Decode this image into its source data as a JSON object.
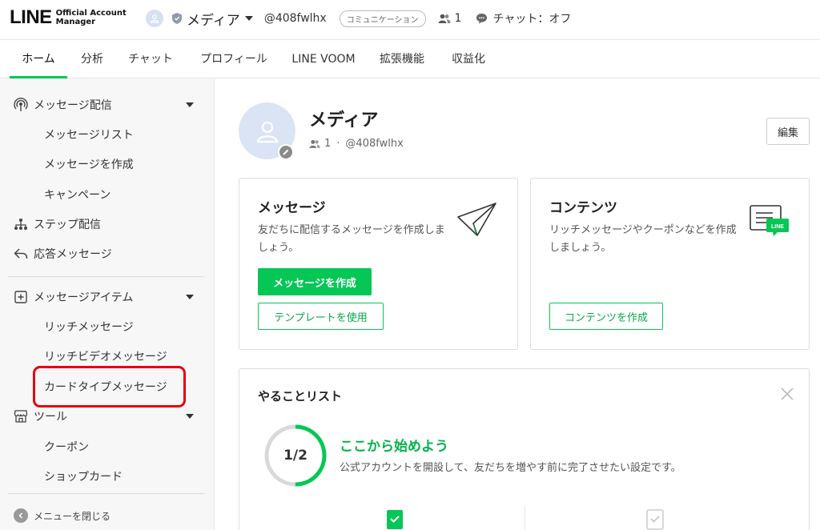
{
  "header": {
    "logo_main": "LINE",
    "logo_sub_1": "Official Account",
    "logo_sub_2": "Manager",
    "account_name": "メディア",
    "account_id": "@408fwlhx",
    "plan_badge": "コミュニケーション",
    "member_count": "1",
    "chat_status": "チャット：オフ"
  },
  "tabs": [
    {
      "label": "ホーム",
      "active": true
    },
    {
      "label": "分析"
    },
    {
      "label": "チャット"
    },
    {
      "label": "プロフィール"
    },
    {
      "label": "LINE VOOM"
    },
    {
      "label": "拡張機能"
    },
    {
      "label": "収益化"
    }
  ],
  "sidebar": {
    "message_delivery": "メッセージ配信",
    "message_list": "メッセージリスト",
    "create_message": "メッセージを作成",
    "campaign": "キャンペーン",
    "step_delivery": "ステップ配信",
    "auto_reply": "応答メッセージ",
    "message_items": "メッセージアイテム",
    "rich_message": "リッチメッセージ",
    "rich_video_message": "リッチビデオメッセージ",
    "card_type_message": "カードタイプメッセージ",
    "tools": "ツール",
    "coupon": "クーポン",
    "shop_card": "ショップカード",
    "close_menu": "メニューを閉じる"
  },
  "profile": {
    "name": "メディア",
    "member_count": "1",
    "separator": "·",
    "id": "@408fwlhx",
    "edit_label": "編集"
  },
  "message_card": {
    "title": "メッセージ",
    "description": "友だちに配信するメッセージを作成しましょう。",
    "primary_button": "メッセージを作成",
    "secondary_button": "テンプレートを使用"
  },
  "content_card": {
    "title": "コンテンツ",
    "description": "リッチメッセージやクーポンなどを作成しましょう。",
    "button": "コンテンツを作成",
    "icon_badge": "LINE"
  },
  "todo": {
    "title": "やることリスト",
    "progress_label": "1/2",
    "progress_fraction": 0.5,
    "heading": "ここから始めよう",
    "description": "公式アカウントを開設して、友だちを増やす前に完了させたい設定です。"
  },
  "colors": {
    "brand_green": "#06c755",
    "highlight_red": "#e60012"
  }
}
